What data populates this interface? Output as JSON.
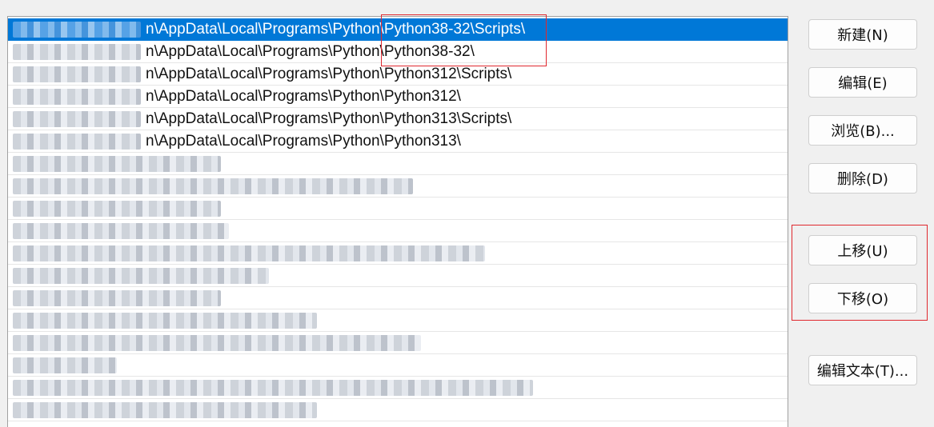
{
  "path_list": {
    "rows": [
      {
        "text": "n\\AppData\\Local\\Programs\\Python\\Python38-32\\Scripts\\",
        "selected": true
      },
      {
        "text": "n\\AppData\\Local\\Programs\\Python\\Python38-32\\",
        "selected": false
      },
      {
        "text": "n\\AppData\\Local\\Programs\\Python\\Python312\\Scripts\\",
        "selected": false
      },
      {
        "text": "n\\AppData\\Local\\Programs\\Python\\Python312\\",
        "selected": false
      },
      {
        "text": "n\\AppData\\Local\\Programs\\Python\\Python313\\Scripts\\",
        "selected": false
      },
      {
        "text": "n\\AppData\\Local\\Programs\\Python\\Python313\\",
        "selected": false
      },
      {
        "text": "",
        "selected": false
      },
      {
        "text": "",
        "selected": false
      },
      {
        "text": "",
        "selected": false
      },
      {
        "text": "",
        "selected": false
      },
      {
        "text": "",
        "selected": false
      },
      {
        "text": "",
        "selected": false
      },
      {
        "text": "",
        "selected": false
      },
      {
        "text": "",
        "selected": false
      },
      {
        "text": "",
        "selected": false
      },
      {
        "text": "",
        "selected": false
      },
      {
        "text": "",
        "selected": false
      },
      {
        "text": "",
        "selected": false
      }
    ]
  },
  "buttons": {
    "new": "新建(N)",
    "edit": "编辑(E)",
    "browse": "浏览(B)...",
    "delete": "删除(D)",
    "move_up": "上移(U)",
    "move_down": "下移(O)",
    "edit_text": "编辑文本(T)..."
  },
  "colors": {
    "selection": "#0078d7",
    "annotation": "#e0282e"
  }
}
